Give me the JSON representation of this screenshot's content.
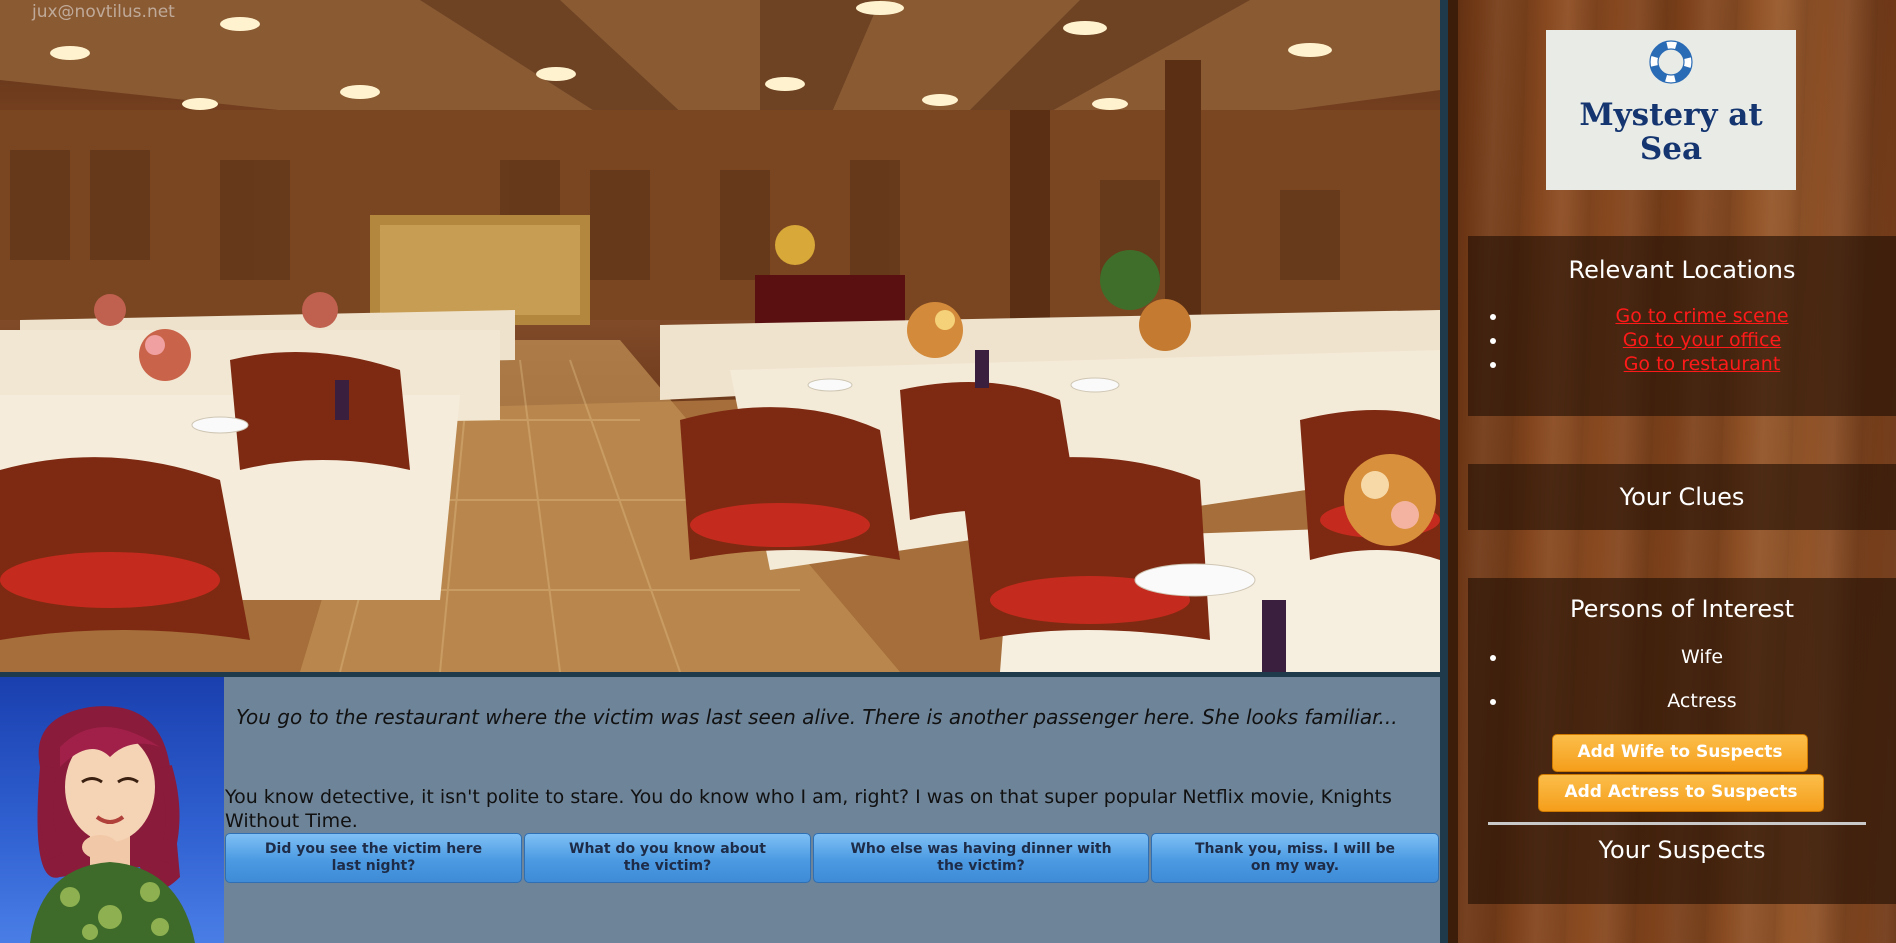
{
  "watermark": "jux@novtilus.net",
  "scene": {
    "description_icon": "restaurant-background"
  },
  "dialogue": {
    "narration": "You go to the restaurant where the victim was last seen alive. There is another passenger here. She looks familiar...",
    "speech": "You know detective, it isn't polite to stare. You do know who I am, right? I was on that super popular Netflix movie, Knights Without Time.",
    "choices": [
      "Did you see the victim here last night?",
      "What do you know about the victim?",
      "Who else was having dinner with the victim?",
      "Thank you, miss. I will be on my way."
    ]
  },
  "sidebar": {
    "logo_title": "Mystery at Sea",
    "logo_icon": "lifebuoy-icon",
    "locations": {
      "title": "Relevant Locations",
      "items": [
        "Go to crime scene",
        "Go to your office",
        "Go to restaurant"
      ]
    },
    "clues": {
      "title": "Your Clues"
    },
    "persons": {
      "title": "Persons of Interest",
      "items": [
        "Wife",
        "Actress"
      ],
      "buttons": [
        "Add Wife to Suspects",
        "Add Actress to Suspects"
      ]
    },
    "suspects": {
      "title": "Your Suspects"
    }
  },
  "colors": {
    "link": "#ff1a1a",
    "button_orange": "#f59e1b",
    "choice_blue": "#4b9ae2",
    "dialogue_bg": "#6e8499",
    "logo_text": "#14356f"
  }
}
